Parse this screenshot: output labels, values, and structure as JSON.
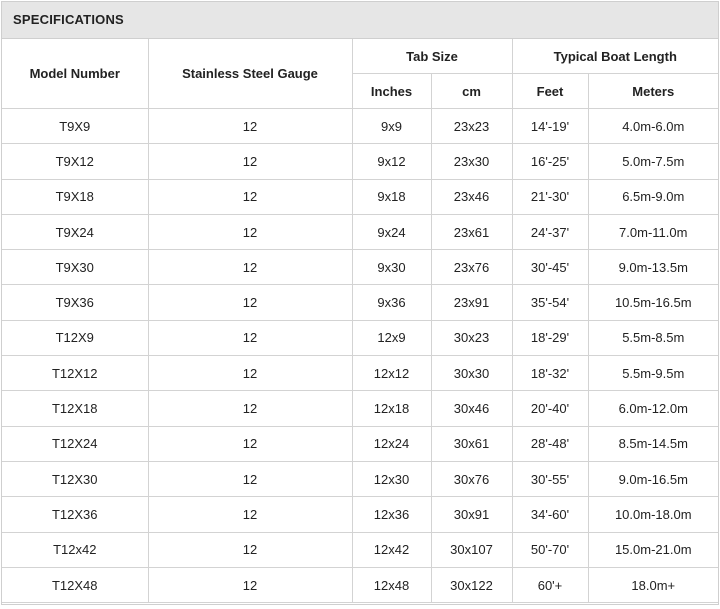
{
  "section_title": "SPECIFICATIONS",
  "headers": {
    "model_number": "Model Number",
    "gauge": "Stainless Steel Gauge",
    "tab_size": "Tab Size",
    "boat_length": "Typical Boat Length",
    "inches": "Inches",
    "cm": "cm",
    "feet": "Feet",
    "meters": "Meters"
  },
  "rows": [
    {
      "model": "T9X9",
      "gauge": "12",
      "inches": "9x9",
      "cm": "23x23",
      "feet": "14'-19'",
      "meters": "4.0m-6.0m"
    },
    {
      "model": "T9X12",
      "gauge": "12",
      "inches": "9x12",
      "cm": "23x30",
      "feet": "16'-25'",
      "meters": "5.0m-7.5m"
    },
    {
      "model": "T9X18",
      "gauge": "12",
      "inches": "9x18",
      "cm": "23x46",
      "feet": "21'-30'",
      "meters": "6.5m-9.0m"
    },
    {
      "model": "T9X24",
      "gauge": "12",
      "inches": "9x24",
      "cm": "23x61",
      "feet": "24'-37'",
      "meters": "7.0m-11.0m"
    },
    {
      "model": "T9X30",
      "gauge": "12",
      "inches": "9x30",
      "cm": "23x76",
      "feet": "30'-45'",
      "meters": "9.0m-13.5m"
    },
    {
      "model": "T9X36",
      "gauge": "12",
      "inches": "9x36",
      "cm": "23x91",
      "feet": "35'-54'",
      "meters": "10.5m-16.5m"
    },
    {
      "model": "T12X9",
      "gauge": "12",
      "inches": "12x9",
      "cm": "30x23",
      "feet": "18'-29'",
      "meters": "5.5m-8.5m"
    },
    {
      "model": "T12X12",
      "gauge": "12",
      "inches": "12x12",
      "cm": "30x30",
      "feet": "18'-32'",
      "meters": "5.5m-9.5m"
    },
    {
      "model": "T12X18",
      "gauge": "12",
      "inches": "12x18",
      "cm": "30x46",
      "feet": "20'-40'",
      "meters": "6.0m-12.0m"
    },
    {
      "model": "T12X24",
      "gauge": "12",
      "inches": "12x24",
      "cm": "30x61",
      "feet": "28'-48'",
      "meters": "8.5m-14.5m"
    },
    {
      "model": "T12X30",
      "gauge": "12",
      "inches": "12x30",
      "cm": "30x76",
      "feet": "30'-55'",
      "meters": "9.0m-16.5m"
    },
    {
      "model": "T12X36",
      "gauge": "12",
      "inches": "12x36",
      "cm": "30x91",
      "feet": "34'-60'",
      "meters": "10.0m-18.0m"
    },
    {
      "model": "T12x42",
      "gauge": "12",
      "inches": "12x42",
      "cm": "30x107",
      "feet": "50'-70'",
      "meters": "15.0m-21.0m"
    },
    {
      "model": "T12X48",
      "gauge": "12",
      "inches": "12x48",
      "cm": "30x122",
      "feet": "60'+",
      "meters": "18.0m+"
    }
  ]
}
